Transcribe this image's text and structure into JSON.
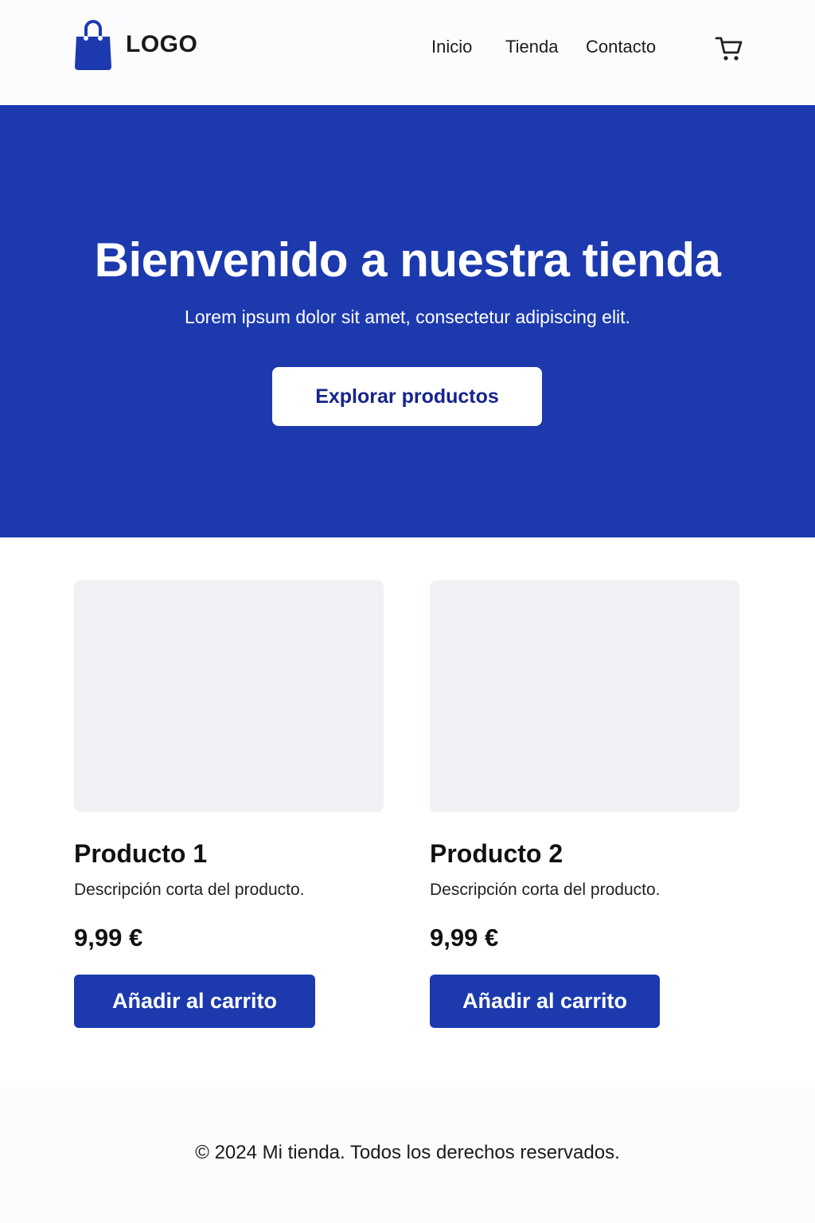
{
  "header": {
    "logo_text": "LOGO",
    "logo_icon": "shopping-bag-icon",
    "nav": [
      "Inicio",
      "Tienda",
      "Contacto"
    ],
    "cart_icon": "cart-icon"
  },
  "hero": {
    "title": "Bienvenido a nuestra tienda",
    "subtitle": "Lorem ipsum dolor sit amet, consectetur adipiscing elit.",
    "button_label": "Explorar productos"
  },
  "products": [
    {
      "name": "Producto 1",
      "description": "Descripción corta del producto.",
      "price": "9,99 €",
      "button_label": "Añadir al carrito"
    },
    {
      "name": "Producto 2",
      "description": "Descripción corta del producto.",
      "price": "9,99 €",
      "button_label": "Añadir al carrito"
    }
  ],
  "footer": {
    "text": "© 2024 Mi tienda. Todos los derechos reservados."
  },
  "colors": {
    "primary": "#1c3aae",
    "hero_button_text": "#16258a",
    "image_placeholder": "#eff1f5",
    "header_bg": "#fcfcfe"
  }
}
